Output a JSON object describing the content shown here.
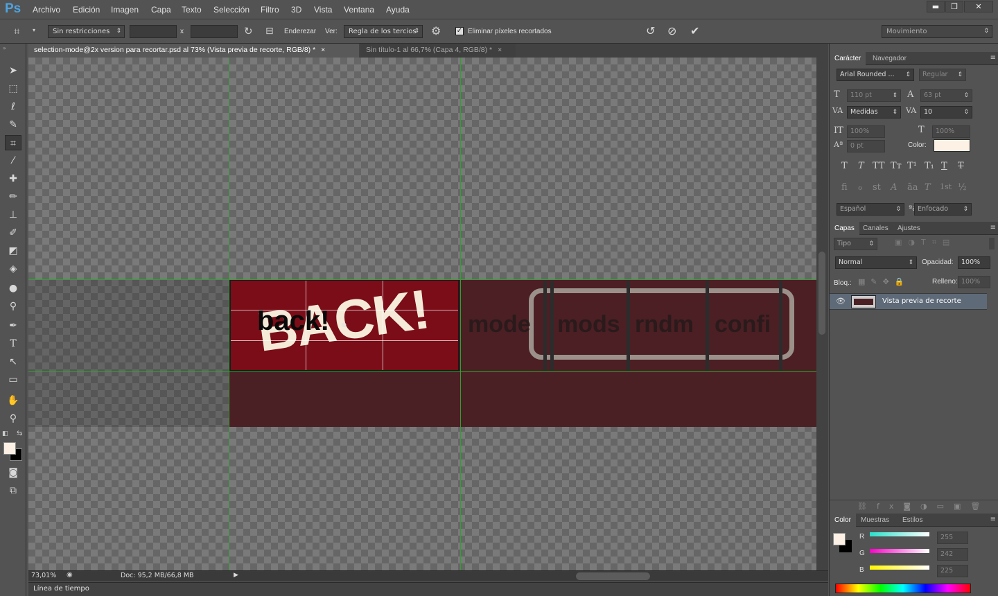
{
  "app": {
    "logo": "Ps"
  },
  "menu": [
    "Archivo",
    "Edición",
    "Imagen",
    "Capa",
    "Texto",
    "Selección",
    "Filtro",
    "3D",
    "Vista",
    "Ventana",
    "Ayuda"
  ],
  "window_controls": {
    "minimize": "▬",
    "restore": "❐",
    "close": "✕"
  },
  "options": {
    "ratio": "Sin restricciones",
    "ratio_separator": "x",
    "straighten": "Enderezar",
    "view_label": "Ver:",
    "view_value": "Regla de los tercios",
    "delete_cropped": "Eliminar píxeles recortados",
    "workspace": "Movimiento"
  },
  "tabs": [
    {
      "label": "selection-mode@2x version para recortar.psd al 73% (Vista previa de recorte, RGB/8) *",
      "close": "×"
    },
    {
      "label": "Sin título-1 al 66,7% (Capa 4, RGB/8) *",
      "close": "×"
    }
  ],
  "canvas": {
    "back_outline": "BACK!",
    "back_text": "back!",
    "modes": [
      "mode",
      "mods",
      "rndm",
      "confi"
    ],
    "colors": {
      "strip": "#4b2024",
      "selected": "#7a0d17",
      "outline_text": "#f5ead8",
      "pill_border": "#9b918a",
      "crop_overlay": "#2a2a2a"
    }
  },
  "status": {
    "zoom": "73,01%",
    "doc": "Doc: 95,2 MB/66,8 MB"
  },
  "timeline": "Línea de tiempo",
  "character_panel": {
    "tabs": [
      "Carácter",
      "Navegador"
    ],
    "font_family": "Arial Rounded ...",
    "font_style": "Regular",
    "size": "110 pt",
    "leading": "63 pt",
    "kerning": "Medidas",
    "tracking": "10",
    "vscale": "100%",
    "hscale": "100%",
    "baseline": "0 pt",
    "color_label": "Color:",
    "text_color": "#fdf1e6",
    "language": "Español",
    "aa_icon": "ªa",
    "antialias": "Enfocado",
    "style_buttons": [
      "T",
      "T",
      "TT",
      "Tт",
      "T¹",
      "T₁",
      "T",
      "T"
    ],
    "opentype_buttons": [
      "ﬁ",
      "ℴ",
      "st",
      "A",
      "ãa",
      "T",
      "1st",
      "½"
    ]
  },
  "layers_panel": {
    "tabs": [
      "Capas",
      "Canales",
      "Ajustes"
    ],
    "filter": "Tipo",
    "blend_mode": "Normal",
    "opacity_label": "Opacidad:",
    "opacity": "100%",
    "lock_label": "Bloq.:",
    "fill_label": "Relleno:",
    "fill": "100%",
    "layers": [
      {
        "name": "Vista previa de recorte",
        "visible": true
      }
    ]
  },
  "color_panel": {
    "tabs": [
      "Color",
      "Muestras",
      "Estilos"
    ],
    "channels": [
      {
        "label": "R",
        "value": "255"
      },
      {
        "label": "G",
        "value": "242"
      },
      {
        "label": "B",
        "value": "225"
      }
    ]
  },
  "tools": [
    "move",
    "marquee",
    "lasso",
    "quick-select",
    "crop",
    "eyedropper",
    "healing",
    "brush",
    "stamp",
    "history-brush",
    "eraser",
    "gradient",
    "blur",
    "dodge",
    "pen",
    "type",
    "path-select",
    "shape",
    "hand",
    "zoom"
  ]
}
